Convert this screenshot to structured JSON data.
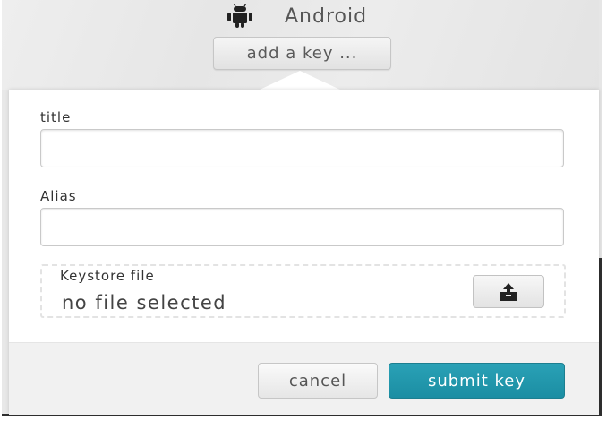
{
  "header": {
    "platform_icon": "android-icon",
    "platform_label": "Android",
    "add_key_label": "add a key ..."
  },
  "form": {
    "title_label": "title",
    "title_value": "",
    "alias_label": "Alias",
    "alias_value": "",
    "keystore_label": "Keystore file",
    "keystore_status": "no file selected",
    "upload_icon": "upload-icon"
  },
  "footer": {
    "cancel_label": "cancel",
    "submit_label": "submit key"
  },
  "colors": {
    "accent": "#1f94a8",
    "button_text": "#555555"
  }
}
